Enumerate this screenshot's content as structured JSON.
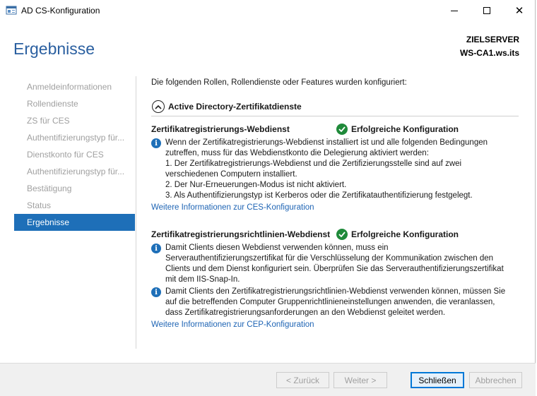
{
  "window": {
    "title": "AD CS-Konfiguration"
  },
  "header": {
    "page_title": "Ergebnisse",
    "server_label": "ZIELSERVER",
    "server_name": "WS-CA1.ws.its"
  },
  "nav": {
    "items": [
      {
        "label": "Anmeldeinformationen"
      },
      {
        "label": "Rollendienste"
      },
      {
        "label": "ZS für CES"
      },
      {
        "label": "Authentifizierungstyp für..."
      },
      {
        "label": "Dienstkonto für CES"
      },
      {
        "label": "Authentifizierungstyp für..."
      },
      {
        "label": "Bestätigung"
      },
      {
        "label": "Status"
      },
      {
        "label": "Ergebnisse"
      }
    ],
    "active_index": 8
  },
  "content": {
    "intro": "Die folgenden Rollen, Rollendienste oder Features wurden konfiguriert:",
    "group_title": "Active Directory-Zertifikatdienste",
    "sections": [
      {
        "title": "Zertifikatregistrierungs-Webdienst",
        "status": "Erfolgreiche Konfiguration",
        "infos": [
          {
            "lines": [
              "Wenn der Zertifikatregistrierungs-Webdienst installiert ist und alle folgenden Bedingungen",
              "zutreffen, muss für das Webdienstkonto die Delegierung aktiviert werden:",
              "1. Der Zertifikatregistrierungs-Webdienst und die Zertifizierungsstelle sind auf zwei",
              "verschiedenen Computern installiert.",
              "2. Der Nur-Erneuerungen-Modus ist nicht aktiviert.",
              "3. Als Authentifizierungstyp ist Kerberos oder die Zertifikatauthentifizierung festgelegt."
            ]
          }
        ],
        "link": "Weitere Informationen zur CES-Konfiguration"
      },
      {
        "title": "Zertifikatregistrierungsrichtlinien-Webdienst",
        "status": "Erfolgreiche Konfiguration",
        "infos": [
          {
            "lines": [
              "Damit Clients diesen Webdienst verwenden können, muss ein",
              "Serverauthentifizierungszertifikat für die Verschlüsselung der Kommunikation zwischen den",
              "Clients und dem Dienst konfiguriert sein. Überprüfen Sie das Serverauthentifizierungszertifikat",
              "mit dem IIS-Snap-In."
            ]
          },
          {
            "lines": [
              "Damit Clients den Zertifikatregistrierungsrichtlinien-Webdienst verwenden können, müssen Sie",
              "auf die betreffenden Computer Gruppenrichtlinieneinstellungen anwenden, die veranlassen,",
              "dass Zertifikatregistrierungsanforderungen an den Webdienst geleitet werden."
            ]
          }
        ],
        "link": "Weitere Informationen zur CEP-Konfiguration"
      }
    ]
  },
  "footer": {
    "back_label": "< Zurück",
    "next_label": "Weiter >",
    "close_label": "Schließen",
    "cancel_label": "Abbrechen"
  },
  "colors": {
    "accent": "#1e6fb8",
    "title": "#2a5fa0",
    "success": "#1f8a3a",
    "link": "#1e64b4"
  },
  "icons": [
    "app-icon",
    "minimize-icon",
    "maximize-icon",
    "close-icon",
    "collapse-icon",
    "check-icon",
    "info-icon"
  ]
}
